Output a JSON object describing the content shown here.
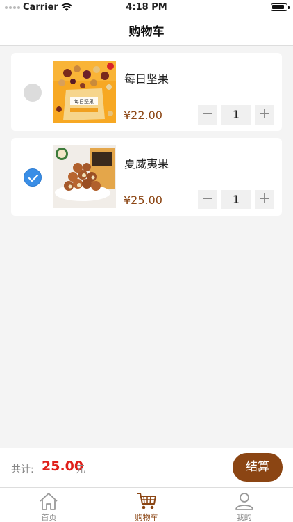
{
  "status_bar": {
    "carrier": "Carrier",
    "time": "4:18 PM"
  },
  "navbar": {
    "title": "购物车"
  },
  "cart": {
    "items": [
      {
        "name": "每日坚果",
        "price": "¥22.00",
        "quantity": "1",
        "selected": false,
        "image": "mixed-nuts-bag-image"
      },
      {
        "name": "夏威夷果",
        "price": "¥25.00",
        "quantity": "1",
        "selected": true,
        "image": "macadamia-nuts-plate-image"
      }
    ],
    "minus_symbol": "−",
    "plus_symbol": "+"
  },
  "checkout": {
    "total_label": "共计:",
    "total_amount": "25.00",
    "total_unit": "元",
    "button_label": "结算"
  },
  "tabs": [
    {
      "label": "首页",
      "icon": "home-icon",
      "active": false
    },
    {
      "label": "购物车",
      "icon": "cart-icon",
      "active": true
    },
    {
      "label": "我的",
      "icon": "user-icon",
      "active": false
    }
  ],
  "colors": {
    "accent": "#8b4513",
    "price_total": "#e0201a",
    "check_selected": "#3a8ee6"
  }
}
